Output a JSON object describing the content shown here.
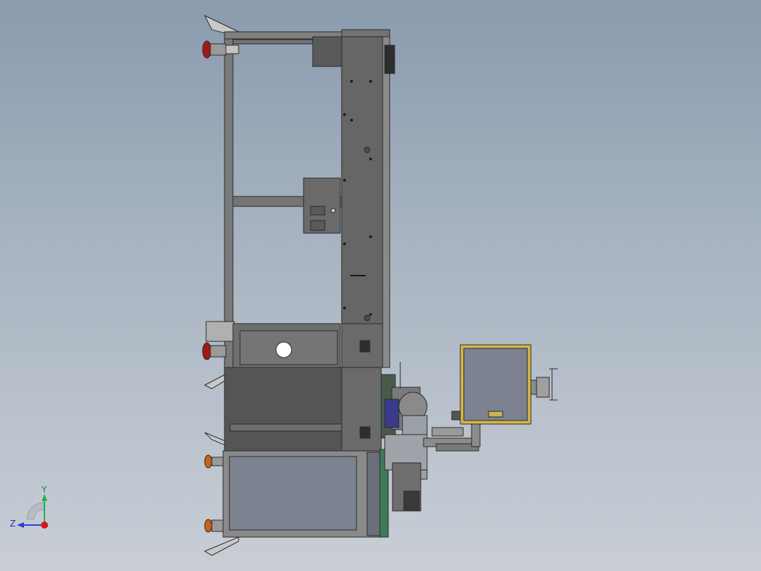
{
  "triad": {
    "y_label": "Y",
    "z_label": "Z",
    "colors": {
      "y": "#22b14c",
      "z": "#2a3fd6",
      "origin": "#d11a1a"
    }
  },
  "model": {
    "colors": {
      "frame": "#6e6e6e",
      "frame_dark": "#3a3a3a",
      "panel": "#5c5c5c",
      "cabinet": "#7c8290",
      "monitor_bezel": "#d4b64a",
      "knob_red": "#a01818",
      "knob_orange": "#c8621a"
    }
  }
}
